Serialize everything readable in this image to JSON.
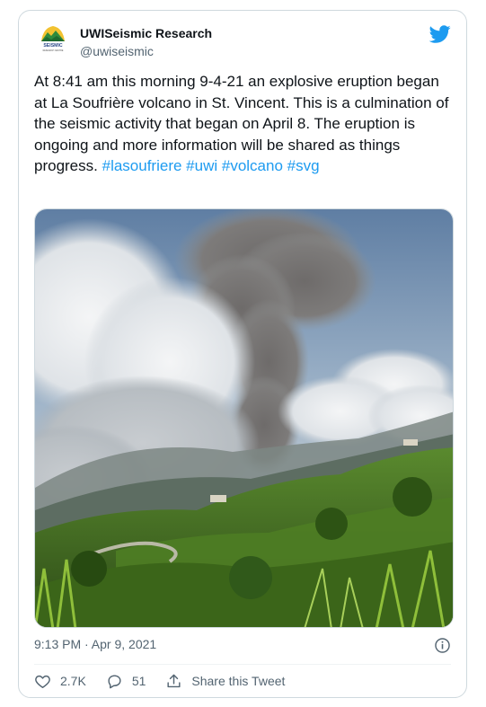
{
  "author": {
    "name": "UWISeismic Research",
    "handle": "@uwiseismic",
    "logo_text": "SEISMIC",
    "logo_subtext": "RESEARCH CENTRE"
  },
  "tweet": {
    "text": "At 8:41 am this morning 9-4-21 an explosive eruption began at La Soufrière volcano in St. Vincent. This is a culmination of the seismic activity that began on April 8. The eruption is ongoing and more information will be shared as things progress.",
    "hashtags": [
      "#lasoufriere",
      "#uwi",
      "#volcano",
      "#svg"
    ],
    "timestamp": "9:13 PM · Apr 9, 2021"
  },
  "actions": {
    "like_count": "2.7K",
    "reply_count": "51",
    "share_label": "Share this Tweet"
  },
  "icons": {
    "brand": "twitter-bird-icon",
    "info": "info-icon",
    "like": "heart-icon",
    "reply": "reply-icon",
    "share": "share-icon"
  },
  "colors": {
    "twitter_blue": "#1d9bf0",
    "text": "#0f1419",
    "secondary_text": "#536471",
    "border": "#cfd9de"
  }
}
